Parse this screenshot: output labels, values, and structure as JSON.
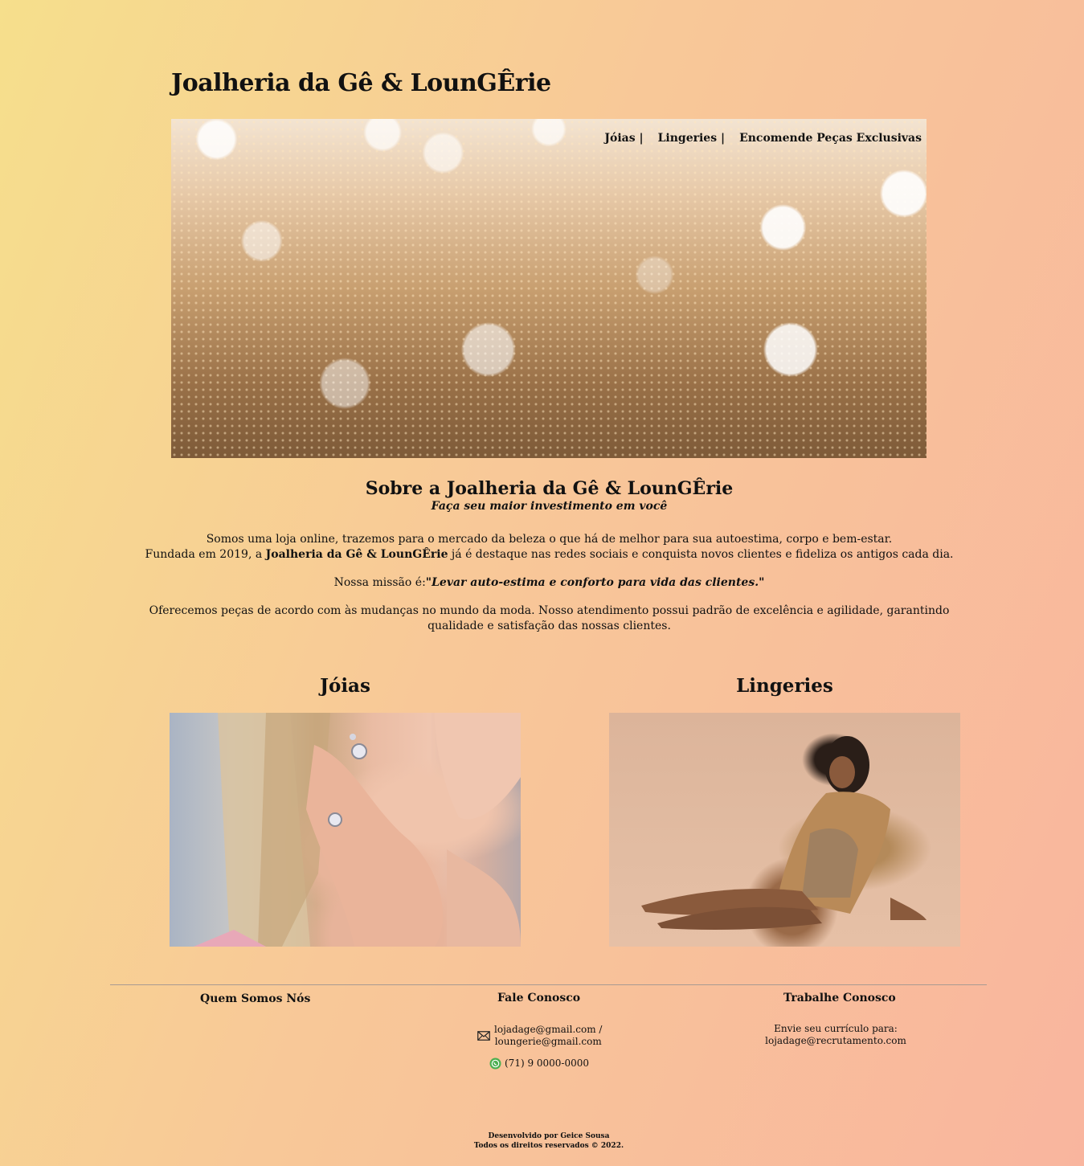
{
  "site_title": "Joalheria da Gê & LounGÊrie",
  "nav": {
    "items": [
      "Jóias |",
      "Lingeries |",
      "Encomende Peças Exclusivas"
    ]
  },
  "about": {
    "title": "Sobre a Joalheria da Gê & LounGÊrie",
    "tagline": "Faça seu maior investimento em você",
    "p1_line1": "Somos uma loja online, trazemos para o mercado da beleza o que há de melhor para sua autoestima, corpo e bem-estar.",
    "p1_line2_prefix": "Fundada em 2019, a ",
    "p1_line2_brand": "Joalheria da Gê & LounGÊrie",
    "p1_line2_suffix": " já é destaque nas redes sociais e conquista novos clientes e fideliza os antigos cada dia.",
    "mission_label": "Nossa missão é:",
    "mission_quote": "\"Levar auto-estima e conforto para vida das clientes.\"",
    "p3": "Oferecemos peças de acordo com às mudanças no mundo da moda. Nosso atendimento possui padrão de excelência e agilidade, garantindo qualidade e satisfação das nossas clientes."
  },
  "products": {
    "jewelry_title": "Jóias",
    "lingerie_title": "Lingeries"
  },
  "footer": {
    "about_heading": "Quem Somos Nós",
    "contact_heading": "Fale Conosco",
    "email_line1": "lojadage@gmail.com /",
    "email_line2": "loungerie@gmail.com",
    "phone": "(71) 9 0000-0000",
    "work_heading": "Trabalhe Conosco",
    "work_line1": "Envie seu currículo para:",
    "work_line2": "lojadage@recrutamento.com",
    "credit_line1": "Desenvolvido por Geice Sousa",
    "credit_line2": "Todos os direitos reservados © 2022."
  },
  "colors": {
    "bg_start": "#f6df8c",
    "bg_end": "#f9b59e",
    "text": "#111111",
    "whatsapp": "#4caf50"
  }
}
